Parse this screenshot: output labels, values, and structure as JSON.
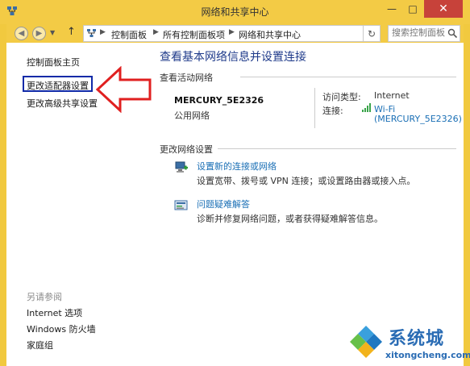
{
  "window": {
    "title": "网络和共享中心",
    "minimize": "—",
    "maximize": "□",
    "close": "✕"
  },
  "address": {
    "crumbs": [
      "控制面板",
      "所有控制面板项",
      "网络和共享中心"
    ],
    "search_placeholder": "搜索控制面板"
  },
  "left_pane": {
    "home": "控制面板主页",
    "change_adapter": "更改适配器设置",
    "change_advanced": "更改高级共享设置",
    "see_also_title": "另请参阅",
    "see_also": [
      "Internet 选项",
      "Windows 防火墙",
      "家庭组"
    ]
  },
  "main": {
    "heading": "查看基本网络信息并设置连接",
    "active_networks_label": "查看活动网络",
    "network": {
      "name": "MERCURY_5E2326",
      "type": "公用网络",
      "access_type_label": "访问类型:",
      "access_type_value": "Internet",
      "connection_label": "连接:",
      "connection_line1": "Wi-Fi",
      "connection_line2": "(MERCURY_5E2326)"
    },
    "change_settings_label": "更改网络设置",
    "tasks": [
      {
        "title": "设置新的连接或网络",
        "desc": "设置宽带、拨号或 VPN 连接；或设置路由器或接入点。"
      },
      {
        "title": "问题疑难解答",
        "desc": "诊断并修复网络问题，或者获得疑难解答信息。"
      }
    ]
  },
  "watermark": {
    "name": "系统城",
    "url": "xitongcheng.com"
  },
  "colors": {
    "titlebar": "#f3cb45",
    "close": "#c7423a",
    "link": "#1a6fb5",
    "heading": "#1e3a8a",
    "highlight_box": "#102aa8",
    "arrow": "#e02020"
  }
}
